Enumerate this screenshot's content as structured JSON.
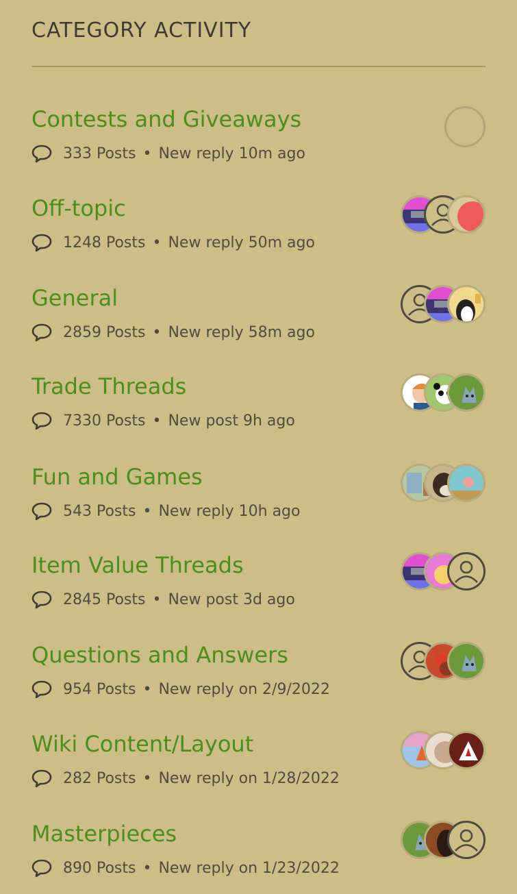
{
  "widget": {
    "title": "CATEGORY ACTIVITY"
  },
  "categories": [
    {
      "name": "Contests and Giveaways",
      "posts": "333 Posts",
      "activity": "New reply 10m ago",
      "avatars": [
        "empty"
      ]
    },
    {
      "name": "Off-topic",
      "posts": "1248 Posts",
      "activity": "New reply 50m ago",
      "avatars": [
        "pink-blue",
        "user-placeholder",
        "red-ball"
      ]
    },
    {
      "name": "General",
      "posts": "2859 Posts",
      "activity": "New reply 58m ago",
      "avatars": [
        "user-placeholder",
        "pink-blue",
        "penguin"
      ]
    },
    {
      "name": "Trade Threads",
      "posts": "7330 Posts",
      "activity": "New post 9h ago",
      "avatars": [
        "cartoon-boy",
        "panda",
        "green-cat"
      ]
    },
    {
      "name": "Fun and Games",
      "posts": "543 Posts",
      "activity": "New reply 10h ago",
      "avatars": [
        "room",
        "dark-creature",
        "teal-scene"
      ]
    },
    {
      "name": "Item Value Threads",
      "posts": "2845 Posts",
      "activity": "New post 3d ago",
      "avatars": [
        "pink-blue",
        "pink-glow",
        "user-placeholder"
      ]
    },
    {
      "name": "Questions and Answers",
      "posts": "954 Posts",
      "activity": "New reply on 2/9/2022",
      "avatars": [
        "user-placeholder",
        "red-creature",
        "green-cat"
      ]
    },
    {
      "name": "Wiki Content/Layout",
      "posts": "282 Posts",
      "activity": "New reply on 1/28/2022",
      "avatars": [
        "fox-blue",
        "pale-face",
        "red-white"
      ]
    },
    {
      "name": "Masterpieces",
      "posts": "890 Posts",
      "activity": "New reply on 1/23/2022",
      "avatars": [
        "green-cat",
        "brown-dark",
        "user-placeholder"
      ]
    }
  ],
  "colors": {
    "background": "#cdbe88",
    "link": "#4a8f1c",
    "text": "#4f4c40"
  }
}
